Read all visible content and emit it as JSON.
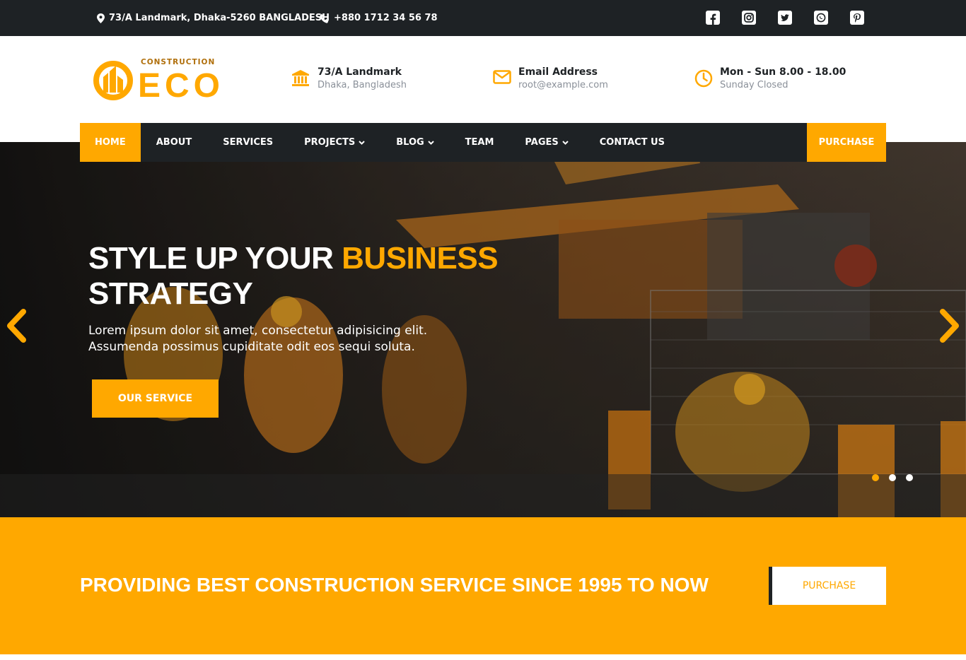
{
  "topbar": {
    "address": "73/A Landmark, Dhaka-5260 BANGLADESH",
    "phone": "+880 1712 34 56 78",
    "socials": [
      "facebook-icon",
      "instagram-icon",
      "twitter-icon",
      "whatsapp-icon",
      "pinterest-icon"
    ]
  },
  "logo": {
    "small": "CONSTRUCTION",
    "big": "ECO"
  },
  "info": {
    "location": {
      "title": "73/A Landmark",
      "subtitle": "Dhaka, Bangladesh"
    },
    "email": {
      "title": "Email Address",
      "subtitle": "root@example.com"
    },
    "hours": {
      "title": "Mon - Sun 8.00 - 18.00",
      "subtitle": "Sunday Closed"
    }
  },
  "nav": {
    "items": [
      {
        "label": "HOME",
        "dropdown": false,
        "active": true
      },
      {
        "label": "ABOUT",
        "dropdown": false
      },
      {
        "label": "SERVICES",
        "dropdown": false
      },
      {
        "label": "PROJECTS",
        "dropdown": true
      },
      {
        "label": "BLOG",
        "dropdown": true
      },
      {
        "label": "TEAM",
        "dropdown": false
      },
      {
        "label": "PAGES",
        "dropdown": true
      },
      {
        "label": "CONTACT US",
        "dropdown": false
      }
    ],
    "purchase": "PURCHASE"
  },
  "hero": {
    "title_white_1": "STYLE UP YOUR ",
    "title_highlight": "BUSINESS",
    "title_white_2": "STRATEGY",
    "subtitle_line1": "Lorem ipsum dolor sit amet, consectetur adipisicing elit.",
    "subtitle_line2": "Assumenda possimus cupiditate odit eos sequi soluta.",
    "button": "OUR SERVICE",
    "slides": 3,
    "active_slide": 1
  },
  "band": {
    "text": "PROVIDING BEST CONSTRUCTION SERVICE SINCE 1995 TO NOW",
    "button": "PURCHASE"
  },
  "colors": {
    "accent": "#ffa800",
    "dark": "#1e2225"
  }
}
